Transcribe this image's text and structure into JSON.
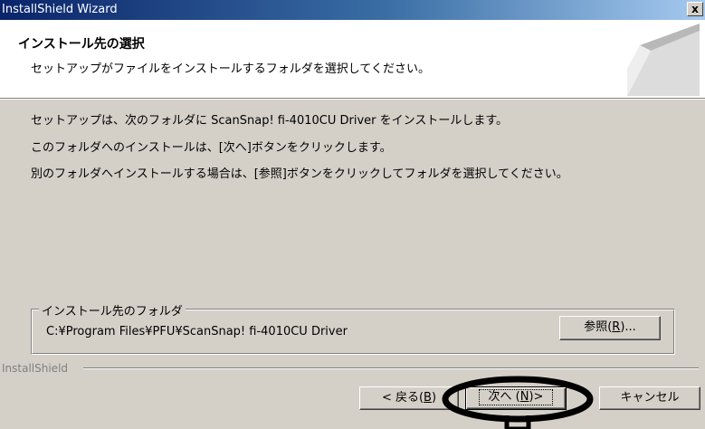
{
  "window": {
    "title": "InstallShield Wizard",
    "close_label": "x"
  },
  "header": {
    "title": "インストール先の選択",
    "subtitle": "セットアップがファイルをインストールするフォルダを選択してください。"
  },
  "body": {
    "line1": "セットアップは、次のフォルダに ScanSnap! fi-4010CU Driver をインストールします。",
    "line2": "このフォルダへのインストールは、[次へ]ボタンをクリックします。",
    "line3": "別のフォルダへインストールする場合は、[参照]ボタンをクリックしてフォルダを選択してください。"
  },
  "destination": {
    "group_label": "インストール先のフォルダ",
    "path": "C:¥Program Files¥PFU¥ScanSnap! fi-4010CU Driver",
    "browse_label": "参照(",
    "browse_key": "R",
    "browse_suffix": ")..."
  },
  "footer": {
    "brand": "InstallShield",
    "back_label": "< 戻る(",
    "back_key": "B",
    "back_suffix": ")",
    "next_label": "次へ (",
    "next_key": "N",
    "next_suffix": ")>",
    "cancel_label": "キャンセル"
  },
  "colors": {
    "title_bar_start": "#0a246a",
    "title_bar_end": "#a6caf0",
    "dialog_face": "#d4d0c8",
    "header_bg": "#ffffff"
  },
  "icons": [
    "close-icon",
    "installshield-logo",
    "highlight-ellipse"
  ]
}
